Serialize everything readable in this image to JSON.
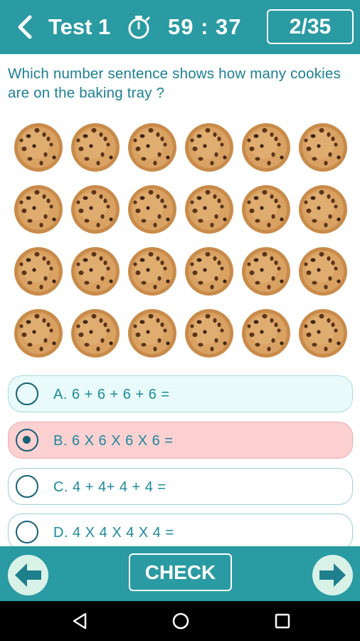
{
  "header": {
    "title": "Test 1",
    "timer": "59 : 37",
    "progress": "2/35"
  },
  "question": {
    "text": "Which number sentence shows how many cookies are on the baking tray ?",
    "cookie_rows": 4,
    "cookie_cols": 6
  },
  "options": [
    {
      "label": "A. 6 + 6 + 6 + 6 =",
      "state": "highlighted"
    },
    {
      "label": "B. 6 X 6 X 6 X 6 =",
      "state": "selected"
    },
    {
      "label": "C. 4 + 4+ 4 + 4 =",
      "state": "default"
    },
    {
      "label": "D. 4 X 4 X 4 X 4 =",
      "state": "default"
    }
  ],
  "footer": {
    "check_label": "CHECK"
  },
  "colors": {
    "primary": "#2a9aa3",
    "question_text": "#1c7f93",
    "selected_option_bg": "#fdd0d2",
    "highlighted_option_bg": "#e9fafb",
    "nav_circle": "#d8f2e8"
  },
  "icons": {
    "back": "chevron-left-icon",
    "timer": "stopwatch-icon",
    "prev": "arrow-left-icon",
    "next": "arrow-right-icon",
    "system_back": "triangle-back-icon",
    "system_home": "circle-home-icon",
    "system_recents": "square-recents-icon"
  }
}
